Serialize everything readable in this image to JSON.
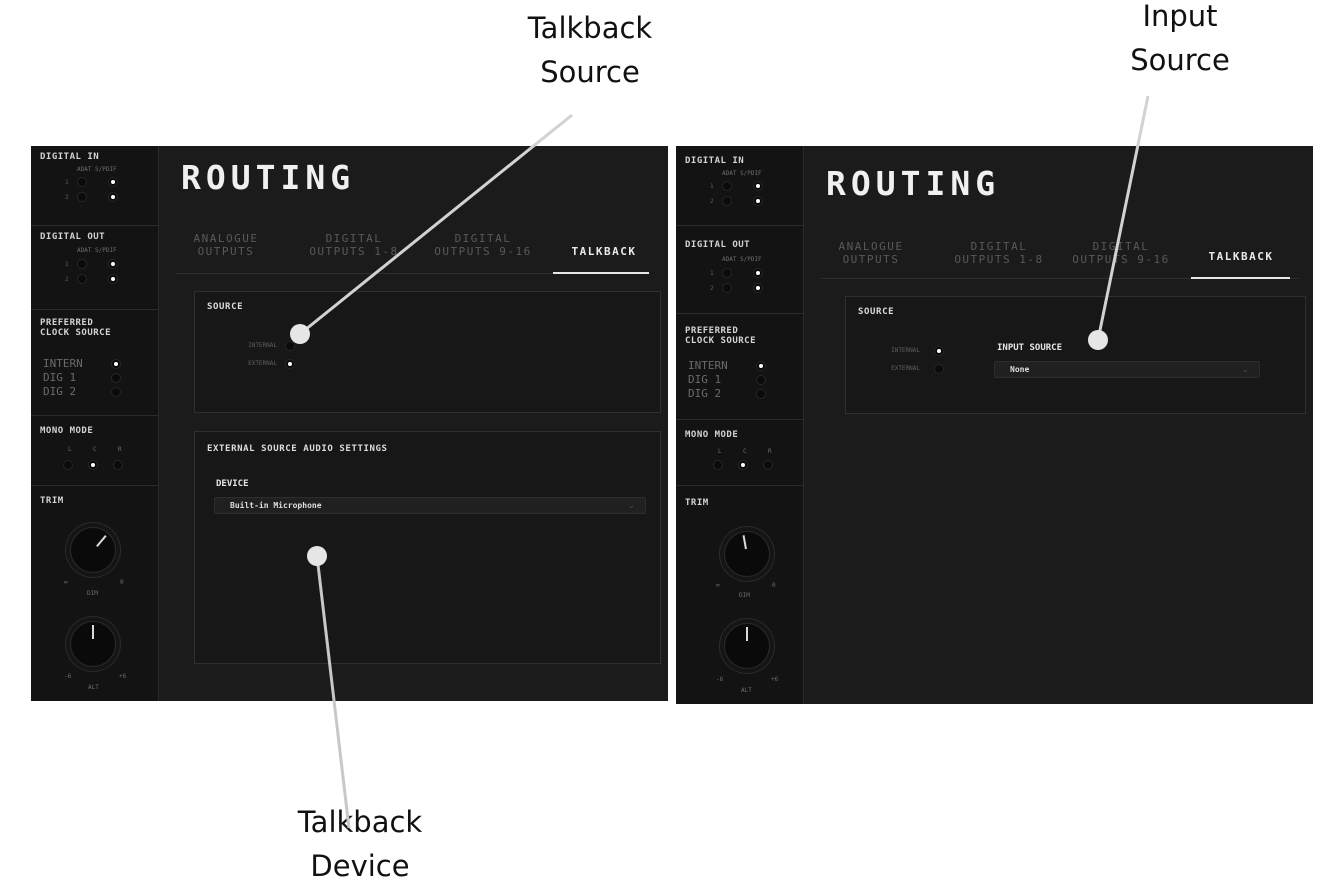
{
  "callouts": {
    "talkback_source": [
      "Talkback",
      "Source"
    ],
    "input_source": [
      "Input",
      "Source"
    ],
    "talkback_device": [
      "Talkback",
      "Device"
    ]
  },
  "sidebar": {
    "digital_in": {
      "title": "DIGITAL IN",
      "cols": [
        "ADAT",
        "S/PDIF"
      ],
      "rows": [
        "1",
        "2"
      ]
    },
    "digital_out": {
      "title": "DIGITAL OUT",
      "cols": [
        "ADAT",
        "S/PDIF"
      ],
      "rows": [
        "1",
        "2"
      ]
    },
    "clock": {
      "title": [
        "PREFERRED",
        "CLOCK SOURCE"
      ],
      "options": [
        "INTERN",
        "DIG 1",
        "DIG 2"
      ],
      "selected": "INTERN"
    },
    "mono": {
      "title": "MONO MODE",
      "options": [
        "L",
        "C",
        "R"
      ],
      "selected": "C"
    },
    "trim": {
      "title": "TRIM",
      "dim_label": "DIM",
      "dim_min": "∞",
      "dim_max": "0",
      "alt_label": "ALT",
      "alt_min": "-6",
      "alt_max": "+6"
    }
  },
  "routing": {
    "title": "ROUTING",
    "tabs": [
      {
        "line1": "ANALOGUE",
        "line2": "OUTPUTS"
      },
      {
        "line1": "DIGITAL",
        "line2": "OUTPUTS 1-8"
      },
      {
        "line1": "DIGITAL",
        "line2": "OUTPUTS 9-16"
      },
      {
        "line1": "TALKBACK",
        "line2": ""
      }
    ],
    "active_tab": "TALKBACK"
  },
  "left": {
    "source_title": "SOURCE",
    "options": [
      "INTERNAL",
      "EXTERNAL"
    ],
    "selected": "EXTERNAL",
    "external_title": "EXTERNAL SOURCE AUDIO SETTINGS",
    "device_label": "DEVICE",
    "device_value": "Built-in Microphone"
  },
  "right": {
    "source_title": "SOURCE",
    "options": [
      "INTERNAL",
      "EXTERNAL"
    ],
    "selected": "INTERNAL",
    "input_source_label": "INPUT SOURCE",
    "input_source_value": "None"
  },
  "icons": {
    "select_arrow": "chevron-down-icon",
    "radio": "radio-dot-icon",
    "knob": "rotary-knob-icon"
  },
  "colors": {
    "panel_bg": "#1b1b1c",
    "sidebar_bg": "#131314",
    "active_text": "#eaeaea",
    "inactive_text": "#595959",
    "indicator_on": "#ffffff"
  }
}
